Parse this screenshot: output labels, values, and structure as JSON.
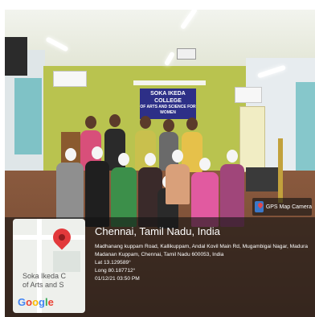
{
  "photo": {
    "banner_line1": "SOKA IKEDA COLLEGE",
    "banner_line2": "OF ARTS AND SCIENCE FOR WOMEN"
  },
  "gps_tag": {
    "label": "GPS Map Camera",
    "icon": "gps-map-camera-icon"
  },
  "map": {
    "place_line1": "Soka Ikeda C",
    "place_line2": "of Arts and S",
    "logo": "Google",
    "icon": "location-pin-icon"
  },
  "location": {
    "city": "Chennai, Tamil Nadu, India",
    "address": "Madhanang kuppam Road, Kallikuppam, Andal Kovil Main Rd, Mugambigai Nagar, Madura Madanan Kuppam, Chennai, Tamil Nadu 600053, India",
    "lat": "Lat 13.129589°",
    "long": "Long 80.187712°",
    "datetime": "01/12/21 03:50 PM"
  },
  "colors": {
    "wall": "#b9c34f",
    "banner": "#2d2f87",
    "overlay": "#141414",
    "pin": "#e2393b"
  }
}
